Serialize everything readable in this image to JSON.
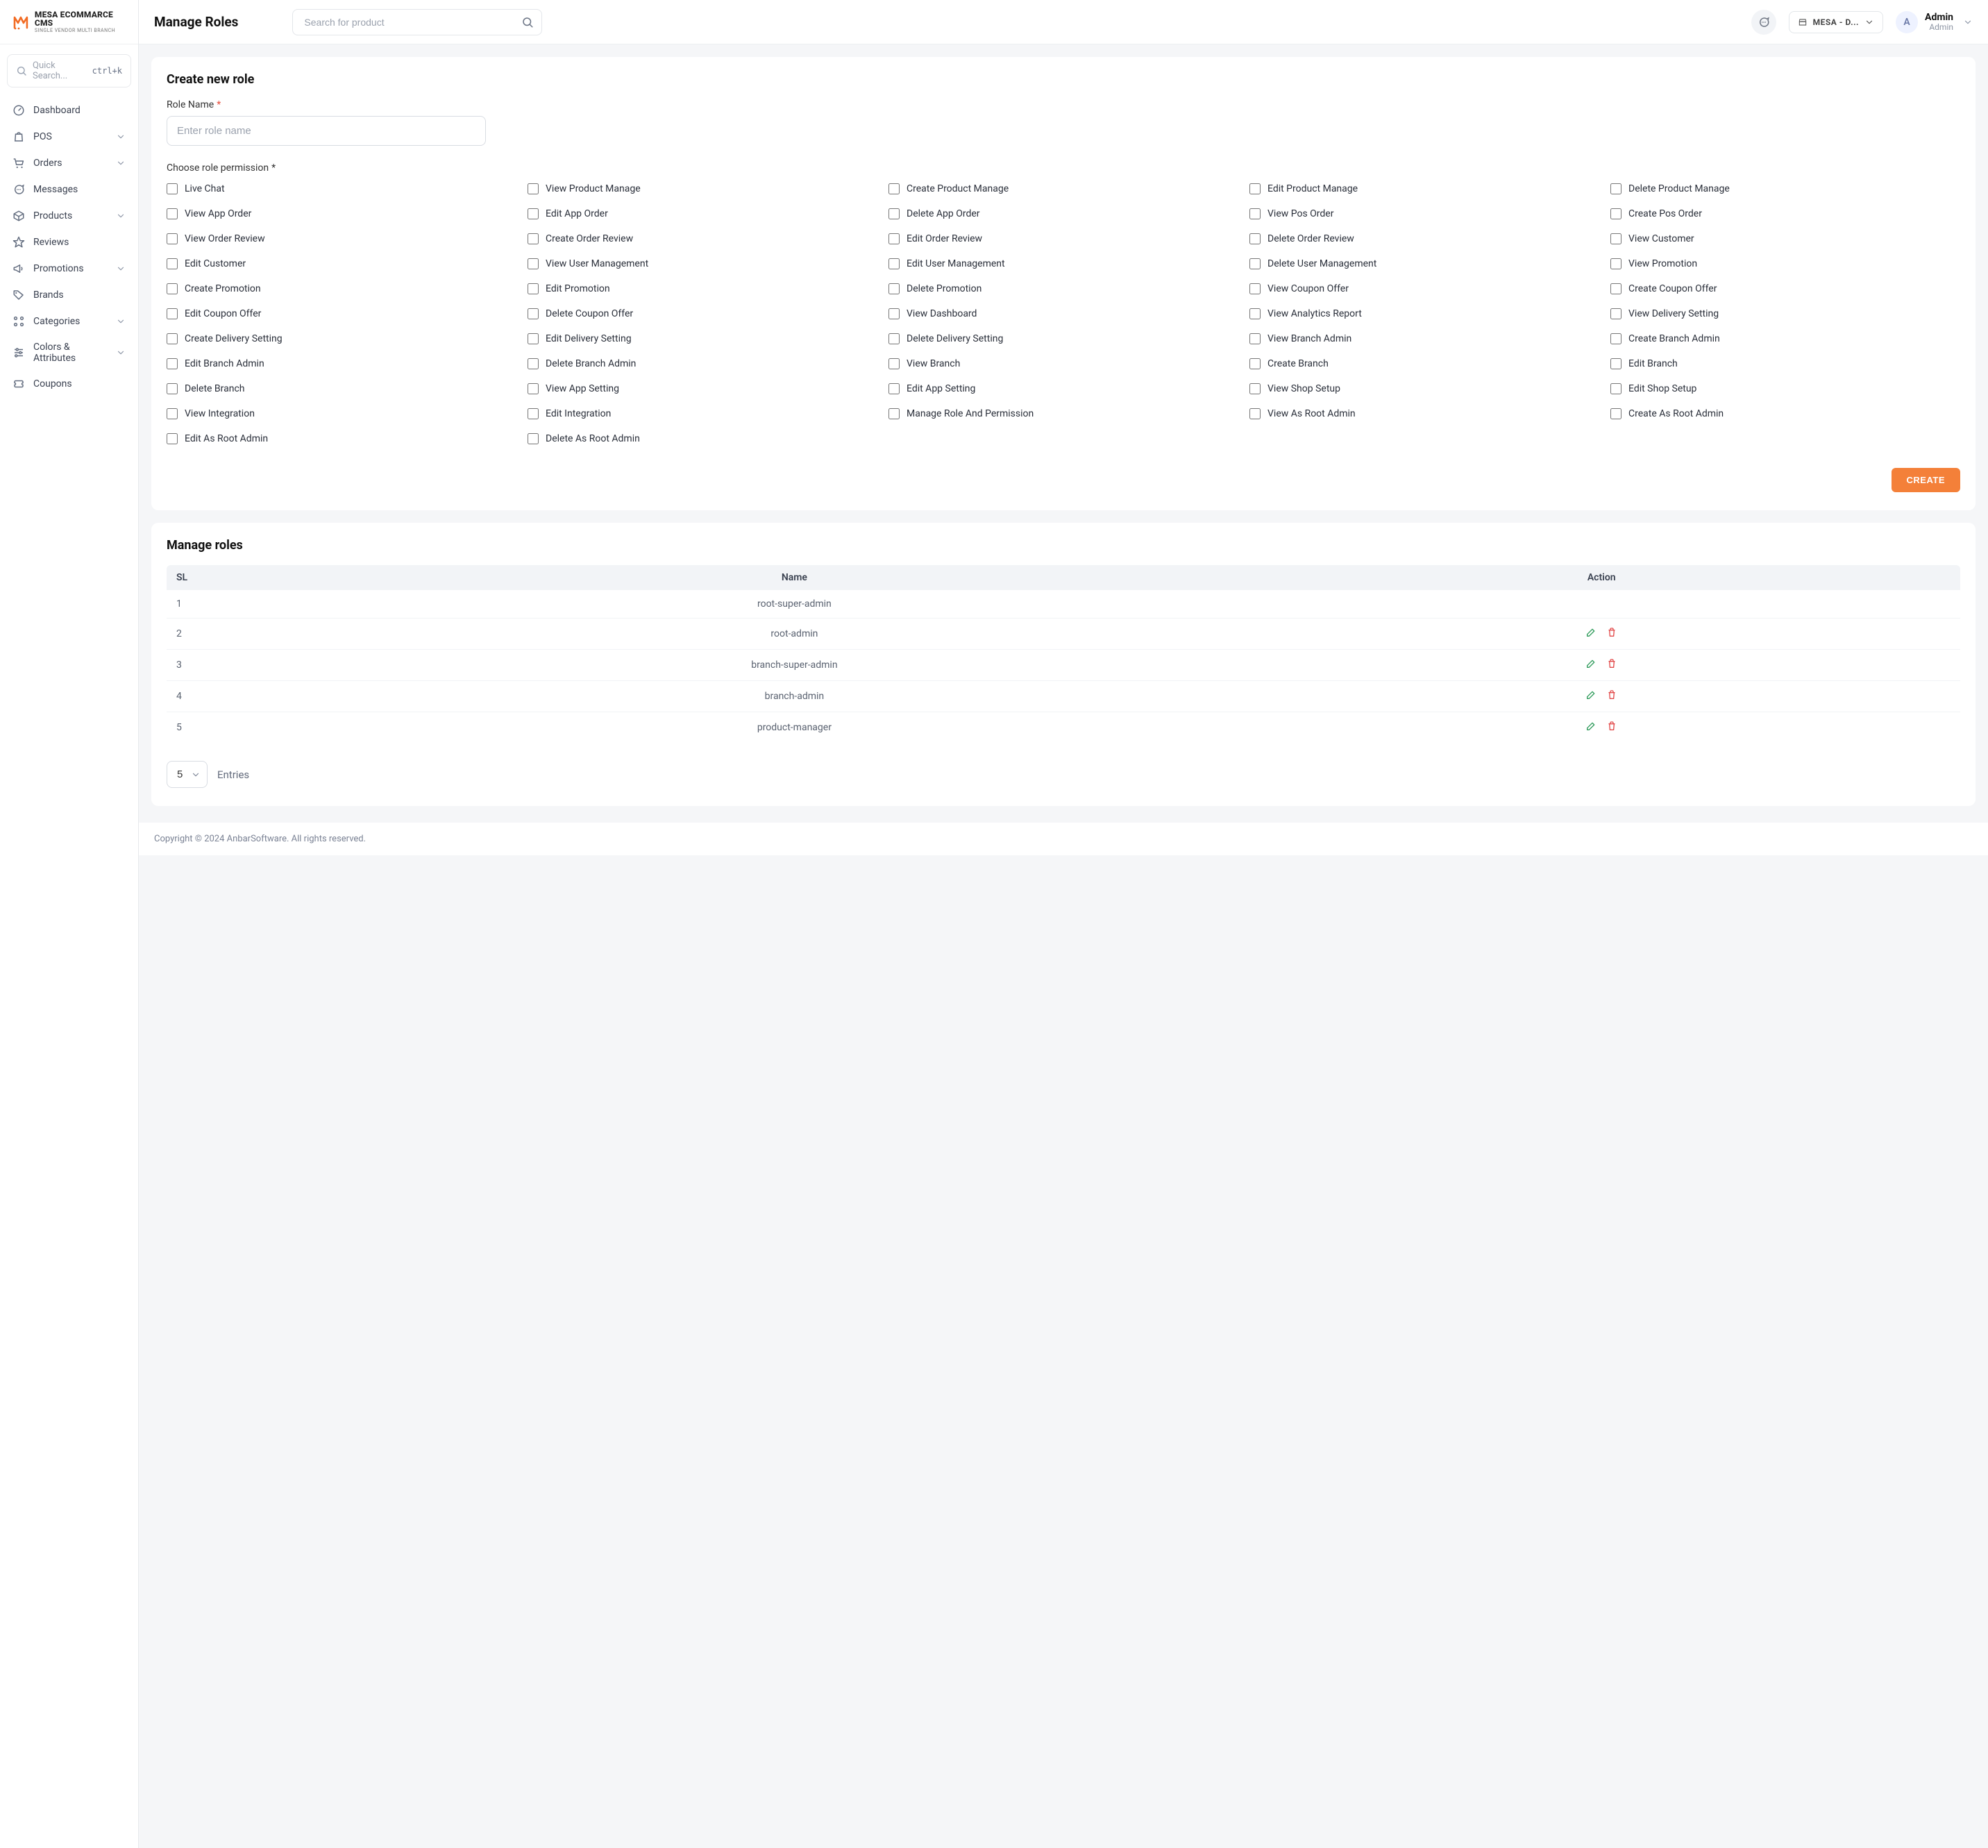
{
  "brand": {
    "logo_text": "MESA ECOMMARCE CMS",
    "logo_sub": "SINGLE VENDOR MULTI BRANCH"
  },
  "sidebar": {
    "search_placeholder": "Quick Search...",
    "search_kbd": "ctrl+k",
    "items": [
      {
        "icon": "gauge",
        "label": "Dashboard",
        "expandable": false
      },
      {
        "icon": "bag",
        "label": "POS",
        "expandable": true
      },
      {
        "icon": "cart",
        "label": "Orders",
        "expandable": true
      },
      {
        "icon": "chat",
        "label": "Messages",
        "expandable": false
      },
      {
        "icon": "box",
        "label": "Products",
        "expandable": true
      },
      {
        "icon": "star",
        "label": "Reviews",
        "expandable": false
      },
      {
        "icon": "megaphone",
        "label": "Promotions",
        "expandable": true
      },
      {
        "icon": "tag",
        "label": "Brands",
        "expandable": false
      },
      {
        "icon": "grid",
        "label": "Categories",
        "expandable": true
      },
      {
        "icon": "sliders",
        "label": "Colors & Attributes",
        "expandable": true
      },
      {
        "icon": "ticket",
        "label": "Coupons",
        "expandable": false
      }
    ]
  },
  "header": {
    "page_title": "Manage Roles",
    "search_placeholder": "Search for product",
    "shop_switch": "MESA - D...",
    "avatar_initial": "A",
    "user_name": "Admin",
    "user_role": "Admin"
  },
  "create": {
    "title": "Create new role",
    "role_label": "Role Name",
    "role_placeholder": "Enter role name",
    "choose_label": "Choose role permission",
    "submit": "CREATE",
    "permissions": [
      "Live Chat",
      "View Product Manage",
      "Create Product Manage",
      "Edit Product Manage",
      "Delete Product Manage",
      "View App Order",
      "Edit App Order",
      "Delete App Order",
      "View Pos Order",
      "Create Pos Order",
      "View Order Review",
      "Create Order Review",
      "Edit Order Review",
      "Delete Order Review",
      "View Customer",
      "Edit Customer",
      "View User Management",
      "Edit User Management",
      "Delete User Management",
      "View Promotion",
      "Create Promotion",
      "Edit Promotion",
      "Delete Promotion",
      "View Coupon Offer",
      "Create Coupon Offer",
      "Edit Coupon Offer",
      "Delete Coupon Offer",
      "View Dashboard",
      "View Analytics Report",
      "View Delivery Setting",
      "Create Delivery Setting",
      "Edit Delivery Setting",
      "Delete Delivery Setting",
      "View Branch Admin",
      "Create Branch Admin",
      "Edit Branch Admin",
      "Delete Branch Admin",
      "View Branch",
      "Create Branch",
      "Edit Branch",
      "Delete Branch",
      "View App Setting",
      "Edit App Setting",
      "View Shop Setup",
      "Edit Shop Setup",
      "View Integration",
      "Edit Integration",
      "Manage Role And Permission",
      "View As Root Admin",
      "Create As Root Admin",
      "Edit As Root Admin",
      "Delete As Root Admin"
    ]
  },
  "list": {
    "title": "Manage roles",
    "columns": {
      "sl": "SL",
      "name": "Name",
      "action": "Action"
    },
    "rows": [
      {
        "sl": "1",
        "name": "root-super-admin",
        "editable": false
      },
      {
        "sl": "2",
        "name": "root-admin",
        "editable": true
      },
      {
        "sl": "3",
        "name": "branch-super-admin",
        "editable": true
      },
      {
        "sl": "4",
        "name": "branch-admin",
        "editable": true
      },
      {
        "sl": "5",
        "name": "product-manager",
        "editable": true
      }
    ],
    "entries_value": "5",
    "entries_label": "Entries"
  },
  "footer": {
    "text": "Copyright © 2024 AnbarSoftware. All rights reserved."
  }
}
